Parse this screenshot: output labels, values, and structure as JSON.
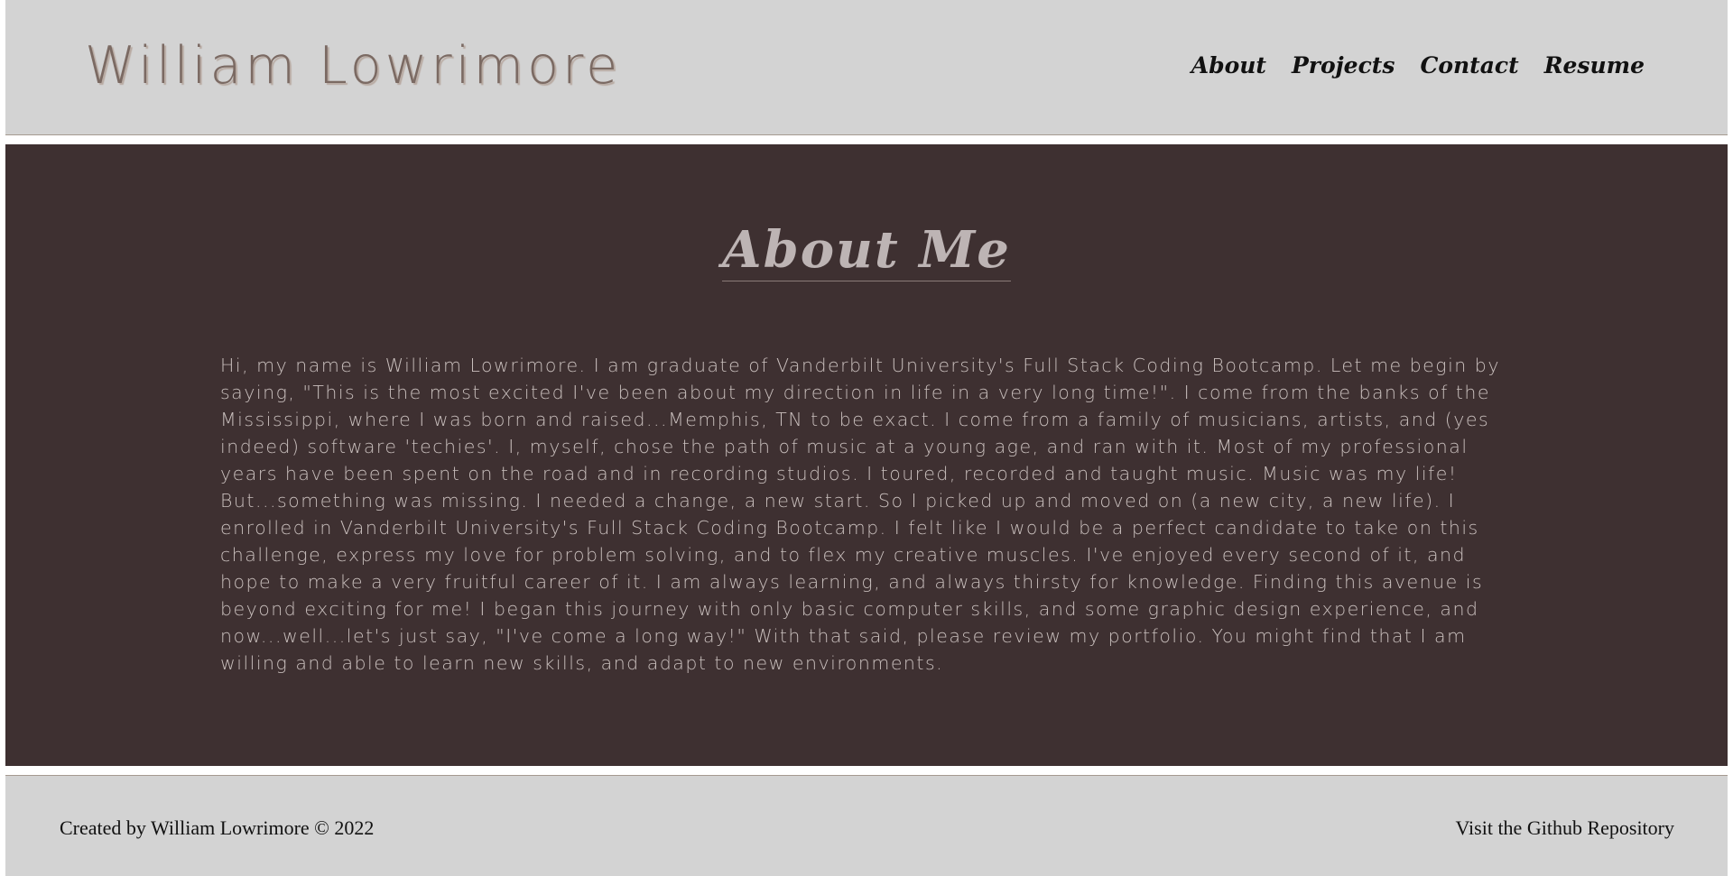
{
  "header": {
    "site_title": "William Lowrimore",
    "nav": [
      {
        "label": "About"
      },
      {
        "label": "Projects"
      },
      {
        "label": "Contact"
      },
      {
        "label": "Resume"
      }
    ]
  },
  "main": {
    "heading": "About Me",
    "paragraph": "Hi, my name is William Lowrimore. I am graduate of Vanderbilt University's Full Stack Coding Bootcamp. Let me begin by saying, \"This is the most excited I've been about my direction in life in a very long time!\". I come from the banks of the Mississippi, where I was born and raised...Memphis, TN to be exact. I come from a family of musicians, artists, and (yes indeed) software 'techies'. I, myself, chose the path of music at a young age, and ran with it. Most of my professional years have been spent on the road and in recording studios. I toured, recorded and taught music. Music was my life! But...something was missing. I needed a change, a new start. So I picked up and moved on (a new city, a new life). I enrolled in Vanderbilt University's Full Stack Coding Bootcamp. I felt like I would be a perfect candidate to take on this challenge, express my love for problem solving, and to flex my creative muscles. I've enjoyed every second of it, and hope to make a very fruitful career of it. I am always learning, and always thirsty for knowledge. Finding this avenue is beyond exciting for me! I began this journey with only basic computer skills, and some graphic design experience, and now...well...let's just say, \"I've come a long way!\" With that said, please review my portfolio. You might find that I am willing and able to learn new skills, and adapt to new environments."
  },
  "footer": {
    "credit": "Created by William Lowrimore © 2022",
    "repo_link": "Visit the Github Repository"
  },
  "colors": {
    "header_bg": "#d3d3d3",
    "main_bg": "#3e3031",
    "title_color": "#7b6a63",
    "heading_color": "#bdb4b4",
    "text_color": "#c9bfbd"
  }
}
